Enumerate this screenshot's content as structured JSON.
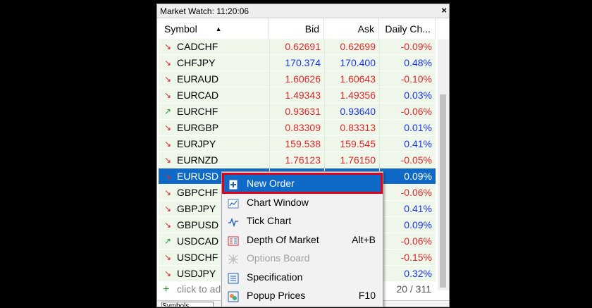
{
  "window": {
    "title": "Market Watch: 11:20:06",
    "close_glyph": "×"
  },
  "columns": {
    "symbol": "Symbol",
    "bid": "Bid",
    "ask": "Ask",
    "change": "Daily Ch..."
  },
  "rows": [
    {
      "symbol": "CADCHF",
      "bid": "0.62691",
      "ask": "0.62699",
      "change": "-0.09%",
      "dir": "down"
    },
    {
      "symbol": "CHFJPY",
      "bid": "170.374",
      "ask": "170.400",
      "change": "0.48%",
      "dir": "down"
    },
    {
      "symbol": "EURAUD",
      "bid": "1.60626",
      "ask": "1.60643",
      "change": "-0.10%",
      "dir": "down"
    },
    {
      "symbol": "EURCAD",
      "bid": "1.49343",
      "ask": "1.49356",
      "change": "0.03%",
      "dir": "down"
    },
    {
      "symbol": "EURCHF",
      "bid": "0.93631",
      "ask": "0.93640",
      "change": "-0.06%",
      "dir": "up"
    },
    {
      "symbol": "EURGBP",
      "bid": "0.83309",
      "ask": "0.83313",
      "change": "0.01%",
      "dir": "down"
    },
    {
      "symbol": "EURJPY",
      "bid": "159.538",
      "ask": "159.545",
      "change": "0.41%",
      "dir": "down"
    },
    {
      "symbol": "EURNZD",
      "bid": "1.76123",
      "ask": "1.76150",
      "change": "-0.05%",
      "dir": "down"
    },
    {
      "symbol": "EURUSD",
      "bid": "",
      "ask": "",
      "change": "0.09%",
      "dir": "down"
    },
    {
      "symbol": "GBPCHF",
      "bid": "",
      "ask": "",
      "change": "-0.06%",
      "dir": "down"
    },
    {
      "symbol": "GBPJPY",
      "bid": "",
      "ask": "",
      "change": "0.41%",
      "dir": "down"
    },
    {
      "symbol": "GBPUSD",
      "bid": "",
      "ask": "",
      "change": "0.09%",
      "dir": "down"
    },
    {
      "symbol": "USDCAD",
      "bid": "",
      "ask": "",
      "change": "-0.06%",
      "dir": "up"
    },
    {
      "symbol": "USDCHF",
      "bid": "",
      "ask": "",
      "change": "-0.15%",
      "dir": "down"
    },
    {
      "symbol": "USDJPY",
      "bid": "",
      "ask": "",
      "change": "0.32%",
      "dir": "down"
    }
  ],
  "add_row": {
    "text": "click to ad",
    "count": "20 / 311"
  },
  "tab": {
    "label": "Symbols"
  },
  "context_menu": {
    "items": [
      {
        "label": "New Order",
        "shortcut": "",
        "icon": "new-order-icon",
        "highlighted": true,
        "disabled": false
      },
      {
        "label": "Chart Window",
        "shortcut": "",
        "icon": "chart-window-icon",
        "highlighted": false,
        "disabled": false
      },
      {
        "label": "Tick Chart",
        "shortcut": "",
        "icon": "tick-chart-icon",
        "highlighted": false,
        "disabled": false
      },
      {
        "label": "Depth Of Market",
        "shortcut": "Alt+B",
        "icon": "depth-of-market-icon",
        "highlighted": false,
        "disabled": false
      },
      {
        "label": "Options Board",
        "shortcut": "",
        "icon": "options-board-icon",
        "highlighted": false,
        "disabled": true
      },
      {
        "label": "Specification",
        "shortcut": "",
        "icon": "specification-icon",
        "highlighted": false,
        "disabled": false
      },
      {
        "label": "Popup Prices",
        "shortcut": "F10",
        "icon": "popup-prices-icon",
        "highlighted": false,
        "disabled": false
      }
    ]
  },
  "colors": {
    "selection": "#0f6ac7",
    "row_bg": "#eef7ea",
    "down": "#e0262a",
    "up": "#1a9a3a",
    "price_red": "#e0262a",
    "price_blue": "#1a34e8",
    "highlight_border": "#e3001b"
  }
}
